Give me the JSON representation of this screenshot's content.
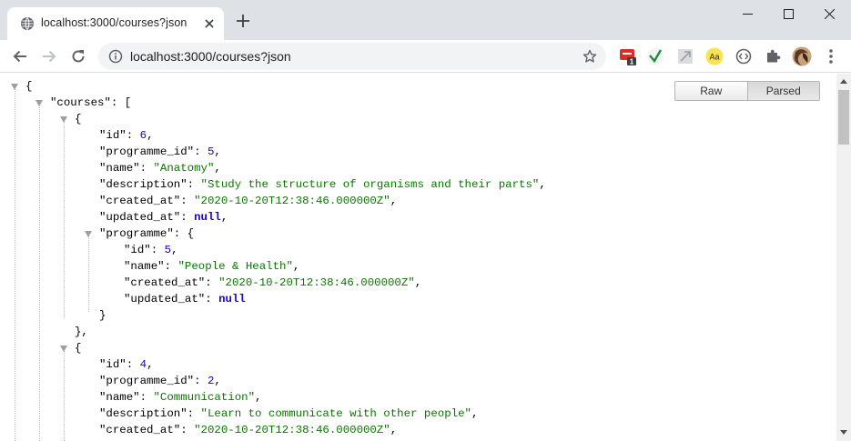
{
  "browser": {
    "tab_title": "localhost:3000/courses?json",
    "url": "localhost:3000/courses?json",
    "extensions": [
      {
        "icon": "red-extension-icon",
        "badge": "1"
      },
      {
        "icon": "green-check-extension-icon"
      },
      {
        "icon": "grey-extension-icon"
      },
      {
        "icon": "yellow-aa-extension-icon",
        "label": "Aa"
      },
      {
        "icon": "code-circle-extension-icon"
      },
      {
        "icon": "puzzle-extensions-icon"
      },
      {
        "icon": "profile-avatar-icon"
      }
    ]
  },
  "viewer": {
    "raw_label": "Raw",
    "parsed_label": "Parsed",
    "active": "Parsed"
  },
  "json": {
    "open_brace": "{",
    "courses_key": "\"courses\"",
    "courses": [
      {
        "id": "6",
        "programme_id": "5",
        "name": "\"Anatomy\"",
        "description": "\"Study the structure of organisms and their parts\"",
        "created_at": "\"2020-10-20T12:38:46.000000Z\"",
        "updated_at": "null",
        "programme": {
          "id": "5",
          "name": "\"People & Health\"",
          "created_at": "\"2020-10-20T12:38:46.000000Z\"",
          "updated_at": "null"
        }
      },
      {
        "id": "4",
        "programme_id": "2",
        "name": "\"Communication\"",
        "description": "\"Learn to communicate with other people\"",
        "created_at": "\"2020-10-20T12:38:46.000000Z\""
      }
    ],
    "keys": {
      "id": "\"id\"",
      "programme_id": "\"programme_id\"",
      "name": "\"name\"",
      "description": "\"description\"",
      "created_at": "\"created_at\"",
      "updated_at": "\"updated_at\"",
      "programme": "\"programme\""
    }
  },
  "colors": {
    "key": "#000000",
    "string": "#0b7500",
    "number": "#1a01cc",
    "literal": "#1a01cc"
  }
}
